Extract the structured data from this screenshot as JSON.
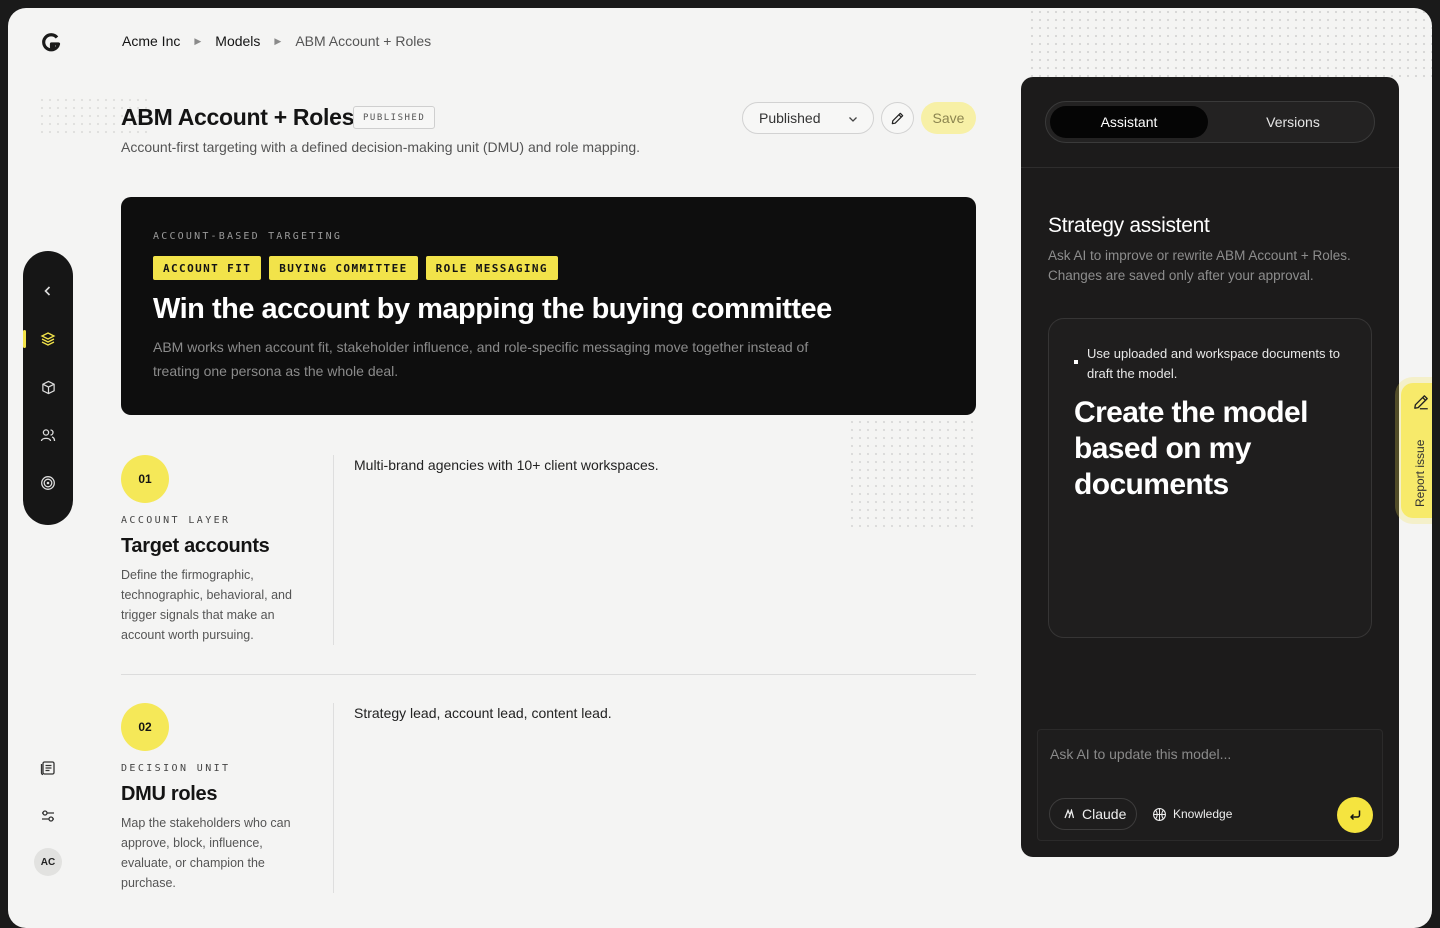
{
  "breadcrumb": {
    "items": [
      "Acme Inc",
      "Models",
      "ABM Account + Roles"
    ]
  },
  "header": {
    "title": "ABM Account + Roles",
    "badge": "PUBLISHED",
    "subtitle": "Account-first targeting with a defined decision-making unit (DMU) and role mapping.",
    "status_value": "Published",
    "save_label": "Save"
  },
  "hero": {
    "kicker": "ACCOUNT-BASED TARGETING",
    "tags": [
      "ACCOUNT FIT",
      "BUYING COMMITTEE",
      "ROLE MESSAGING"
    ],
    "headline": "Win the account by mapping the buying committee",
    "body": "ABM works when account fit, stakeholder influence, and role-specific messaging move together instead of treating one persona as the whole deal."
  },
  "sections": [
    {
      "number": "01",
      "label": "ACCOUNT LAYER",
      "title": "Target accounts",
      "description": "Define the firmographic, technographic, behavioral, and trigger signals that make an account worth pursuing.",
      "content": "Multi-brand agencies with 10+ client workspaces."
    },
    {
      "number": "02",
      "label": "DECISION UNIT",
      "title": "DMU roles",
      "description": "Map the stakeholders who can approve, block, influence, evaluate, or champion the purchase.",
      "content": "Strategy lead, account lead, content lead."
    }
  ],
  "sidebar": {
    "icons": [
      "chevron-left-icon",
      "layers-icon",
      "box-icon",
      "users-icon",
      "target-icon"
    ],
    "bottom_icons": [
      "document-icon",
      "sliders-icon"
    ],
    "avatar_initials": "AC"
  },
  "assistant": {
    "tabs": [
      "Assistant",
      "Versions"
    ],
    "active_tab": "Assistant",
    "title": "Strategy assistent",
    "description": "Ask AI to improve or rewrite ABM Account + Roles. Changes are saved only after your approval.",
    "card_hint": "Use uploaded and workspace documents to draft the model.",
    "card_prompt": "Create the model based on my documents",
    "input_placeholder": "Ask AI to update this model...",
    "model_label": "Claude",
    "knowledge_label": "Knowledge"
  },
  "report": {
    "label": "Report issue"
  },
  "colors": {
    "accent": "#f2e34a",
    "dark": "#0e0e0e",
    "panel": "#1c1b1b",
    "background": "#f4f4f3"
  }
}
